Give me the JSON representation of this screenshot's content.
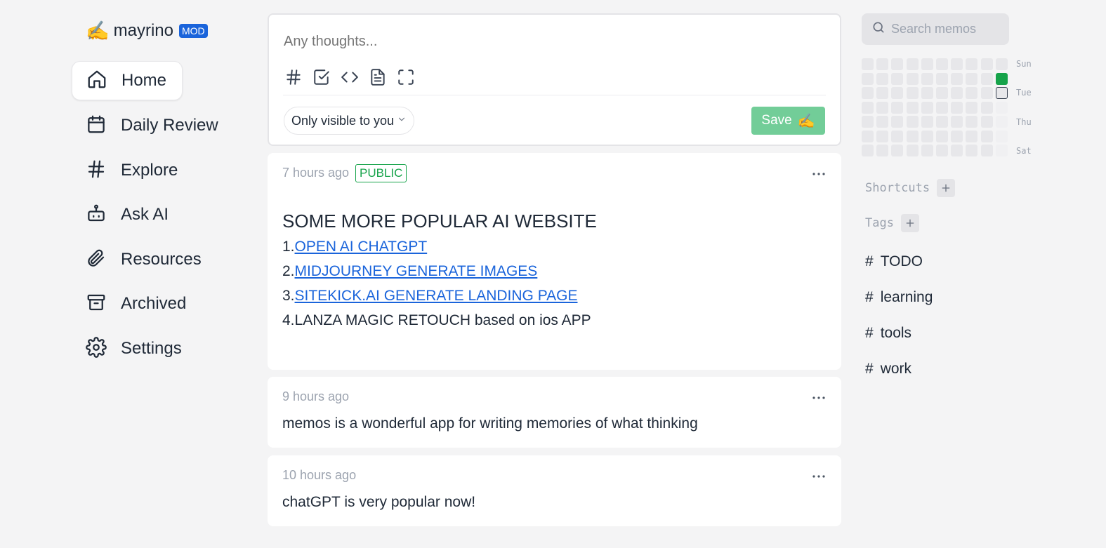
{
  "brand": {
    "emoji": "✍️",
    "name": "mayrino",
    "badge": "MOD"
  },
  "nav": [
    {
      "label": "Home",
      "icon": "home-icon",
      "active": true
    },
    {
      "label": "Daily Review",
      "icon": "calendar-icon"
    },
    {
      "label": "Explore",
      "icon": "hash-icon"
    },
    {
      "label": "Ask AI",
      "icon": "bot-icon"
    },
    {
      "label": "Resources",
      "icon": "paperclip-icon"
    },
    {
      "label": "Archived",
      "icon": "archive-icon"
    },
    {
      "label": "Settings",
      "icon": "gear-icon"
    }
  ],
  "editor": {
    "placeholder": "Any thoughts...",
    "tools": [
      "hash-icon",
      "checkbox-icon",
      "code-icon",
      "file-icon",
      "fullscreen-icon"
    ],
    "visibility": "Only visible to you",
    "save_label": "Save",
    "save_emoji": "✍️"
  },
  "memos": [
    {
      "time": "7 hours ago",
      "badge": "PUBLIC",
      "title": "SOME MORE POPULAR AI WEBSITE",
      "lines": [
        {
          "prefix": "1.",
          "link": "OPEN AI CHATGPT"
        },
        {
          "prefix": "2.",
          "link": "MIDJOURNEY GENERATE IMAGES"
        },
        {
          "prefix": "3.",
          "link": "SITEKICK.AI GENERATE LANDING PAGE"
        },
        {
          "prefix": "4.",
          "text": "LANZA MAGIC RETOUCH based on ios APP"
        }
      ]
    },
    {
      "time": "9 hours ago",
      "text": "memos is a wonderful app for writing memories of what thinking"
    },
    {
      "time": "10 hours ago",
      "text": "chatGPT is very popular now!"
    }
  ],
  "search": {
    "placeholder": "Search memos"
  },
  "heatmap": {
    "day_labels": [
      "Sun",
      "Tue",
      "Thu",
      "Sat"
    ],
    "active_color": "#16a34a"
  },
  "shortcuts": {
    "label": "Shortcuts"
  },
  "tags": {
    "label": "Tags",
    "items": [
      "TODO",
      "learning",
      "tools",
      "work"
    ]
  },
  "colors": {
    "accent": "#1a64db",
    "save": "#72cd98",
    "public": "#16a34a"
  }
}
